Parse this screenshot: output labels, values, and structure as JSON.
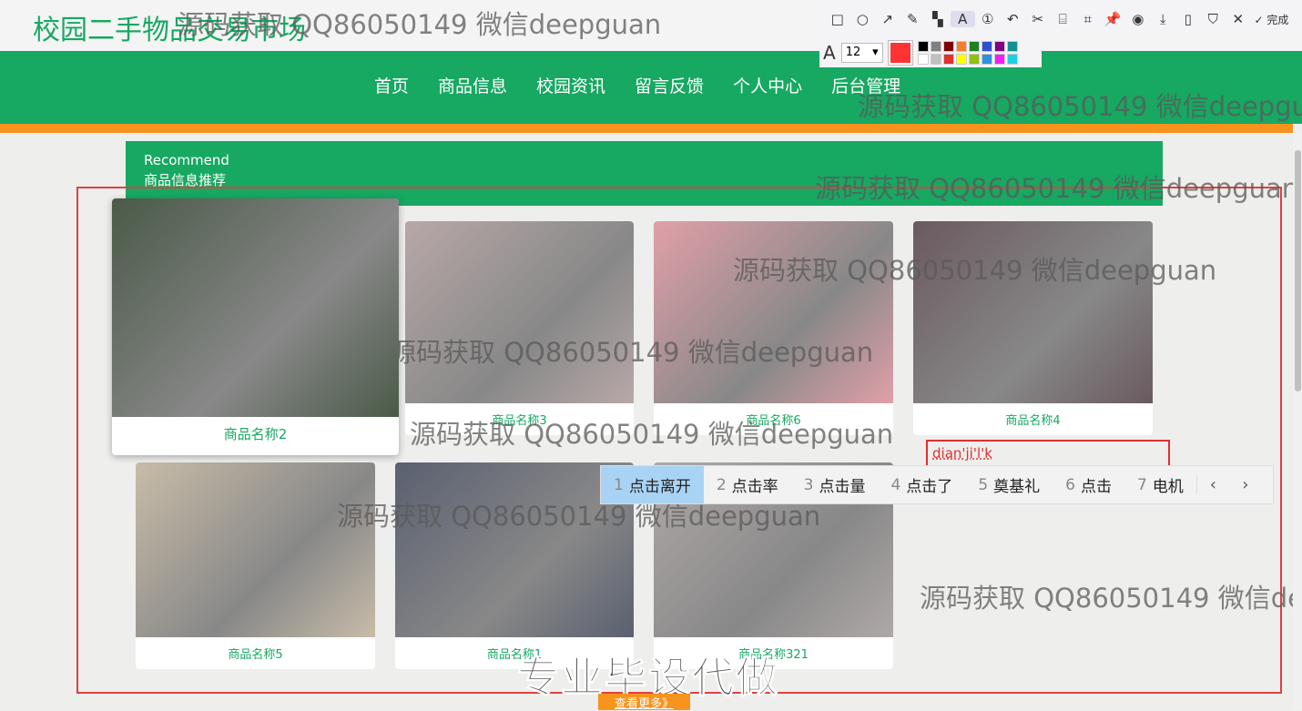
{
  "site": {
    "title": "校园二手物品交易市场"
  },
  "nav": [
    "首页",
    "商品信息",
    "校园资讯",
    "留言反馈",
    "个人中心",
    "后台管理"
  ],
  "recommend": {
    "en": "Recommend",
    "cn": "商品信息推荐"
  },
  "products": [
    {
      "name": "商品名称2",
      "color": "#4a5a48"
    },
    {
      "name": "商品名称3",
      "color": "#b8a8a8"
    },
    {
      "name": "商品名称6",
      "color": "#e0a0a8"
    },
    {
      "name": "商品名称4",
      "color": "#6a5a60"
    },
    {
      "name": "商品名称5",
      "color": "#c8bca8"
    },
    {
      "name": "商品名称1",
      "color": "#5a6070"
    },
    {
      "name": "商品名称321",
      "color": "#b0a8a8"
    }
  ],
  "more_label": "查看更多》",
  "promo": "专业毕设代做",
  "watermark": "源码获取 QQ86050149 微信deepguan",
  "annotation_text": "dian'ji'l'k",
  "ime": {
    "candidates": [
      {
        "n": "1",
        "t": "点击离开"
      },
      {
        "n": "2",
        "t": "点击率"
      },
      {
        "n": "3",
        "t": "点击量"
      },
      {
        "n": "4",
        "t": "点击了"
      },
      {
        "n": "5",
        "t": "奠基礼"
      },
      {
        "n": "6",
        "t": "点击"
      },
      {
        "n": "7",
        "t": "电机"
      }
    ],
    "prev": "‹",
    "next": "›"
  },
  "toolbar": {
    "tools": [
      {
        "n": "rectangle-icon",
        "g": "□"
      },
      {
        "n": "ellipse-icon",
        "g": "○"
      },
      {
        "n": "arrow-icon",
        "g": "↗"
      },
      {
        "n": "pencil-icon",
        "g": "✎"
      },
      {
        "n": "mosaic-icon",
        "g": "▚"
      },
      {
        "n": "text-icon",
        "g": "A"
      },
      {
        "n": "number-icon",
        "g": "①"
      },
      {
        "n": "undo-icon",
        "g": "↶"
      },
      {
        "n": "cut-icon",
        "g": "✂"
      },
      {
        "n": "translate-icon",
        "g": "⌸"
      },
      {
        "n": "ocr-icon",
        "g": "⌗"
      },
      {
        "n": "pin-icon",
        "g": "📌"
      },
      {
        "n": "record-icon",
        "g": "◉"
      },
      {
        "n": "download-icon",
        "g": "⤓"
      },
      {
        "n": "phone-icon",
        "g": "▯"
      },
      {
        "n": "bookmark-icon",
        "g": "⛉"
      },
      {
        "n": "close-icon",
        "g": "✕"
      }
    ],
    "done": "✓ 完成",
    "font_size": "12",
    "palette": [
      "#000000",
      "#808080",
      "#800000",
      "#f08030",
      "#208020",
      "#3050d0",
      "#800080",
      "#109090",
      "#ffffff",
      "#c0c0c0",
      "#e03030",
      "#ffff00",
      "#90c010",
      "#3090e0",
      "#f020f0",
      "#20d0e0"
    ]
  }
}
